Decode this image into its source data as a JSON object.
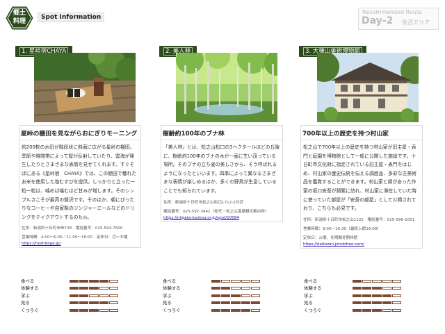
{
  "header": {
    "logo_line1": "郷土",
    "logo_line2": "料理",
    "title": "Spot Information",
    "route_label": "Recommended Route",
    "day": "Day-2",
    "area": "魚沼エリア"
  },
  "rating_labels": [
    "食べる",
    "体験する",
    "学ぶ",
    "見る",
    "くつろぐ"
  ],
  "spots": [
    {
      "tag": "1. 星峠宿CHAYA",
      "title": "星峠の棚田を見ながらおにぎりモーニング",
      "desc": "約200枚の水田が階段状に斜面に広がる星峠の棚田。季節や時間帯によって桜が反射していたり、雲海が発生したりとさまざまな表情を見せてくれます。すぐそばにある《星峠宿　CHAYA》では、この棚田で穫れたお米を使用した塩むすびを提供。しっかりと立った一粒一粒は、噛めば噛むほど甘みが増します。そのシンプルさこそが最高の贅沢です。そのほか、朝にぴったりなコーヒーや自家製のジンジャーエールなどのドリンクをテイクアウトするのも◎。",
      "info1": "住所：新潟県十日町市峠728　電話番号：025-594-7600",
      "info2": "営業時間：4:00〜6:00／11:00〜18:00　定休日：月〜木曜",
      "link": "https://hoshitoge.jp/",
      "ratings": [
        4,
        3,
        2,
        4,
        3
      ]
    },
    {
      "tag": "2. 美人林",
      "title": "樹齢約100年のブナ林",
      "desc": "「美人林」とは、松之山松口の3ヘクタールほどの丘陵に、樹齢約100年のブナの木が一面に生い茂っている場所。そのブナの立ち姿の美しさから、そう呼ばれるようになったといいます。四季によって異なるさまざまな表情が楽しめるほか、多くの野鳥が生息していることでも知られています。",
      "info1": "住所：新潟県十日町市松之山松口1712-2付近",
      "info2": "電話番号：025-597-3442（松代・松之山温泉観光案内所）",
      "link": "https://niigata-kankou.or.jp/spot/10084",
      "ratings": [
        1,
        2,
        3,
        5,
        4
      ]
    },
    {
      "tag": "3. 大棟山美術博物館",
      "title": "700年以上の歴史を持つ村山家",
      "desc": "松之山で700年以上の歴史を持つ村山家が旧主屋・表門と庭園を博物館として一般に公開した施設です。十日町市文化財に指定されている旧主屋・表門をはじめ、村山家の歴史伝統を伝える調度品、多彩な古美術品を鑑賞することができます。村山家と縁があった作家の坂口安吾が頻繁に訪れ、村山家に滞在していた時に使っていた部屋が「安吾の部屋」として公開されており、こちらも必見です。",
      "info1": "住所：新潟県十日町市松之山1122　電話番号：025-596-2051",
      "info2": "営業時間：9:00〜16:30（最終入館16:00）",
      "info3": "定休日：火曜、冬期間冬期休館",
      "link": "https://daitozan.jimdofree.com/",
      "ratings": [
        1,
        3,
        4,
        4,
        3
      ]
    }
  ]
}
